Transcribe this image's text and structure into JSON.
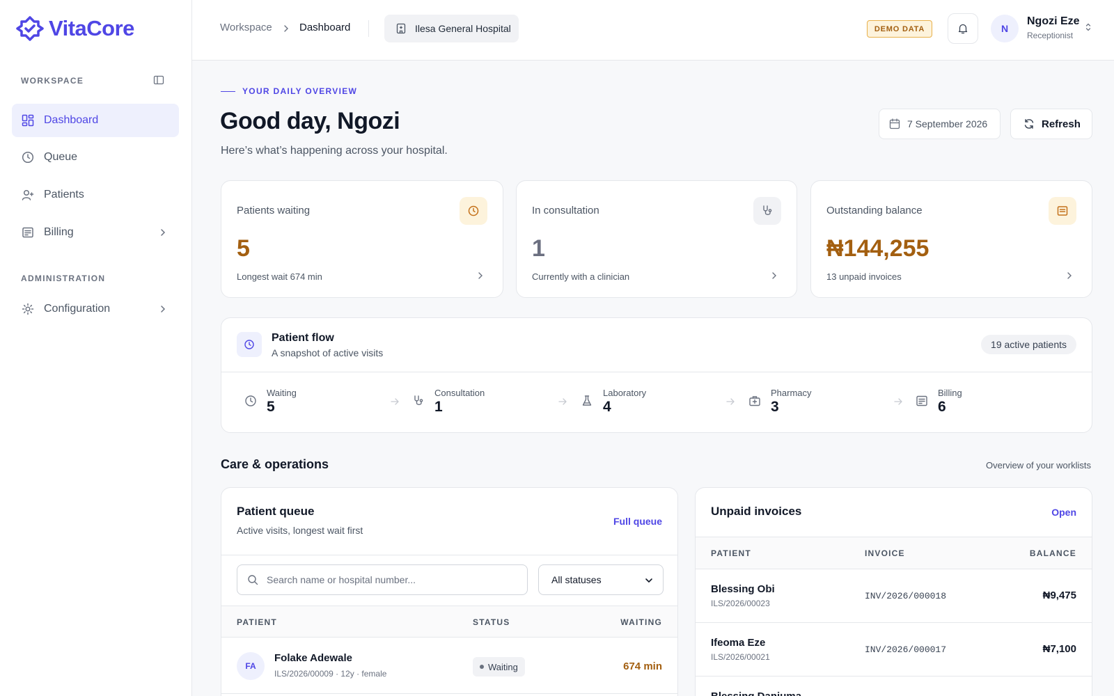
{
  "app": {
    "name": "VitaCore"
  },
  "sidebar": {
    "workspace_label": "WORKSPACE",
    "admin_label": "ADMINISTRATION",
    "items": [
      {
        "label": "Dashboard"
      },
      {
        "label": "Queue"
      },
      {
        "label": "Patients"
      },
      {
        "label": "Billing"
      }
    ],
    "admin_items": [
      {
        "label": "Configuration"
      }
    ]
  },
  "header": {
    "breadcrumb": [
      "Workspace",
      "Dashboard"
    ],
    "hospital": "Ilesa General Hospital",
    "demo_badge": "DEMO DATA",
    "user": {
      "initial": "N",
      "name": "Ngozi Eze",
      "role": "Receptionist"
    }
  },
  "overview": {
    "eyebrow": "YOUR DAILY OVERVIEW",
    "greeting": "Good day, Ngozi",
    "subtitle": "Here’s what’s happening across your hospital.",
    "date": "7 September 2026",
    "refresh_label": "Refresh"
  },
  "stats": [
    {
      "label": "Patients waiting",
      "value": "5",
      "note": "Longest wait 674 min",
      "color": "#a35f10"
    },
    {
      "label": "In consultation",
      "value": "1",
      "note": "Currently with a clinician",
      "color": "#6b6f80"
    },
    {
      "label": "Outstanding balance",
      "value": "₦144,255",
      "note": "13 unpaid invoices",
      "color": "#a35f10"
    }
  ],
  "flow": {
    "title": "Patient flow",
    "subtitle": "A snapshot of active visits",
    "active_pill": "19 active patients",
    "stages": [
      {
        "name": "Waiting",
        "count": "5"
      },
      {
        "name": "Consultation",
        "count": "1"
      },
      {
        "name": "Laboratory",
        "count": "4"
      },
      {
        "name": "Pharmacy",
        "count": "3"
      },
      {
        "name": "Billing",
        "count": "6"
      }
    ]
  },
  "care": {
    "title": "Care & operations",
    "note": "Overview of your worklists"
  },
  "queue": {
    "title": "Patient queue",
    "subtitle": "Active visits, longest wait first",
    "link": "Full queue",
    "search_placeholder": "Search name or hospital number...",
    "status_filter": "All statuses",
    "columns": [
      "PATIENT",
      "STATUS",
      "WAITING"
    ],
    "rows": [
      {
        "initials": "FA",
        "name": "Folake Adewale",
        "meta": "ILS/2026/00009 · 12y · female",
        "status": "Waiting",
        "waiting": "674 min"
      }
    ]
  },
  "invoices": {
    "title": "Unpaid invoices",
    "link": "Open",
    "columns": [
      "PATIENT",
      "INVOICE",
      "BALANCE"
    ],
    "rows": [
      {
        "name": "Blessing Obi",
        "number": "ILS/2026/00023",
        "invoice": "INV/2026/000018",
        "balance": "₦9,475"
      },
      {
        "name": "Ifeoma Eze",
        "number": "ILS/2026/00021",
        "invoice": "INV/2026/000017",
        "balance": "₦7,100"
      },
      {
        "name": "Blessing Danjuma"
      }
    ]
  },
  "colors": {
    "accent": "#4f46e5",
    "warning": "#a35f10"
  }
}
